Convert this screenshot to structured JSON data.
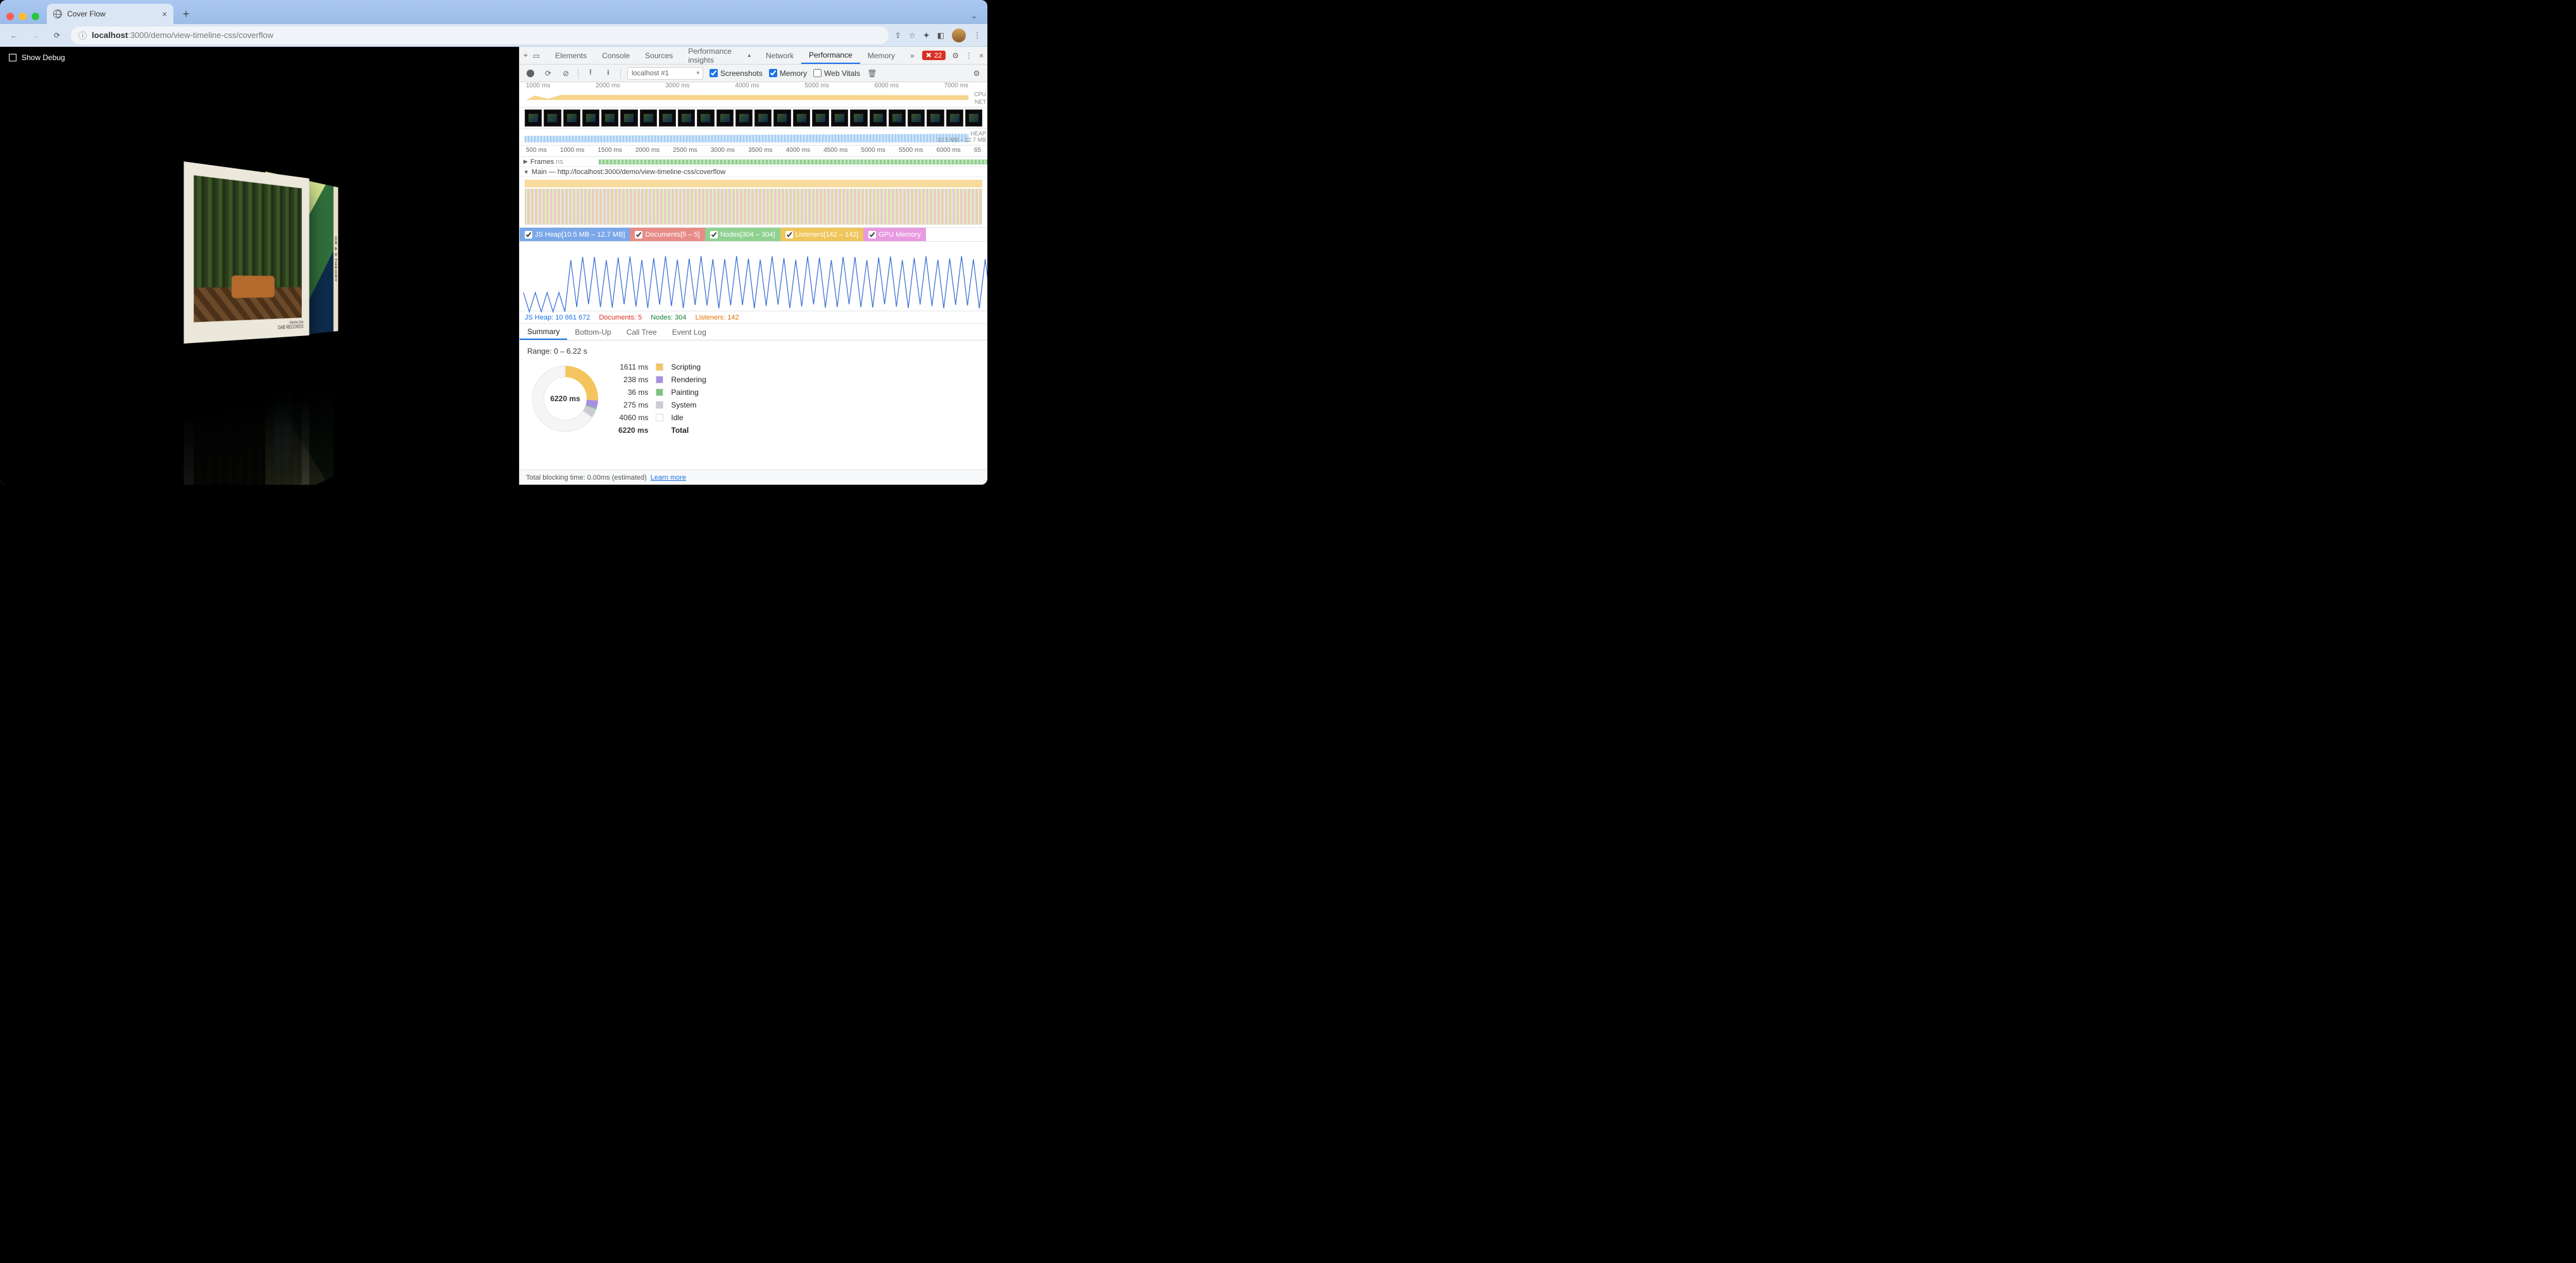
{
  "browser": {
    "tab_title": "Cover Flow",
    "url_host": "localhost",
    "url_port": ":3000",
    "url_path": "/demo/view-timeline-css/coverflow"
  },
  "page": {
    "debug_label": "Show Debug",
    "cover1_sublabel": "Volume One",
    "cover1_label": "DAB RECORDS",
    "cover2_spine": "OR & 9 THEORY"
  },
  "devtools": {
    "tabs": {
      "elements": "Elements",
      "console": "Console",
      "sources": "Sources",
      "perf_insights": "Performance insights",
      "network": "Network",
      "performance": "Performance",
      "memory": "Memory"
    },
    "error_count": "22",
    "toolbar": {
      "context": "localhost #1",
      "screenshots": "Screenshots",
      "memory": "Memory",
      "web_vitals": "Web Vitals"
    },
    "overview_ticks": [
      "1000 ms",
      "2000 ms",
      "3000 ms",
      "4000 ms",
      "5000 ms",
      "6000 ms",
      "7000 ms"
    ],
    "cpu_label": "CPU",
    "net_label": "NET",
    "heap_label": "HEAP",
    "heap_range": "10.5 MB – 12.7 MB",
    "ruler_ticks": [
      "500 ms",
      "1000 ms",
      "1500 ms",
      "2000 ms",
      "2500 ms",
      "3000 ms",
      "3500 ms",
      "4000 ms",
      "4500 ms",
      "5000 ms",
      "5500 ms",
      "6000 ms",
      "65"
    ],
    "frames_label": "Frames",
    "frames_unit": "ns",
    "main_label": "Main — http://localhost:3000/demo/view-timeline-css/coverflow",
    "counters": {
      "heap": "JS Heap[10.5 MB – 12.7 MB]",
      "docs": "Documents[5 – 5]",
      "nodes": "Nodes[304 – 304]",
      "listeners": "Listeners[142 – 142]",
      "gpu": "GPU Memory"
    },
    "stats": {
      "heap": "JS Heap: 10 861 672",
      "docs": "Documents: 5",
      "nodes": "Nodes: 304",
      "listeners": "Listeners: 142"
    },
    "subtabs": {
      "summary": "Summary",
      "bottomup": "Bottom-Up",
      "calltree": "Call Tree",
      "eventlog": "Event Log"
    },
    "summary": {
      "range": "Range: 0 – 6.22 s",
      "total_ms": "6220 ms",
      "rows": [
        {
          "ms": "1611 ms",
          "label": "Scripting",
          "color": "#f4c55f"
        },
        {
          "ms": "238 ms",
          "label": "Rendering",
          "color": "#a98fe0"
        },
        {
          "ms": "36 ms",
          "label": "Painting",
          "color": "#7cc47c"
        },
        {
          "ms": "275 ms",
          "label": "System",
          "color": "#c9ccd0"
        },
        {
          "ms": "4060 ms",
          "label": "Idle",
          "color": "#ffffff"
        }
      ],
      "total_label": "Total"
    },
    "footer": {
      "text": "Total blocking time: 0.00ms (estimated)",
      "link": "Learn more"
    }
  },
  "chart_data": {
    "type": "pie",
    "title": "",
    "categories": [
      "Scripting",
      "Rendering",
      "Painting",
      "System",
      "Idle"
    ],
    "values": [
      1611,
      238,
      36,
      275,
      4060
    ],
    "total": 6220,
    "unit": "ms"
  }
}
